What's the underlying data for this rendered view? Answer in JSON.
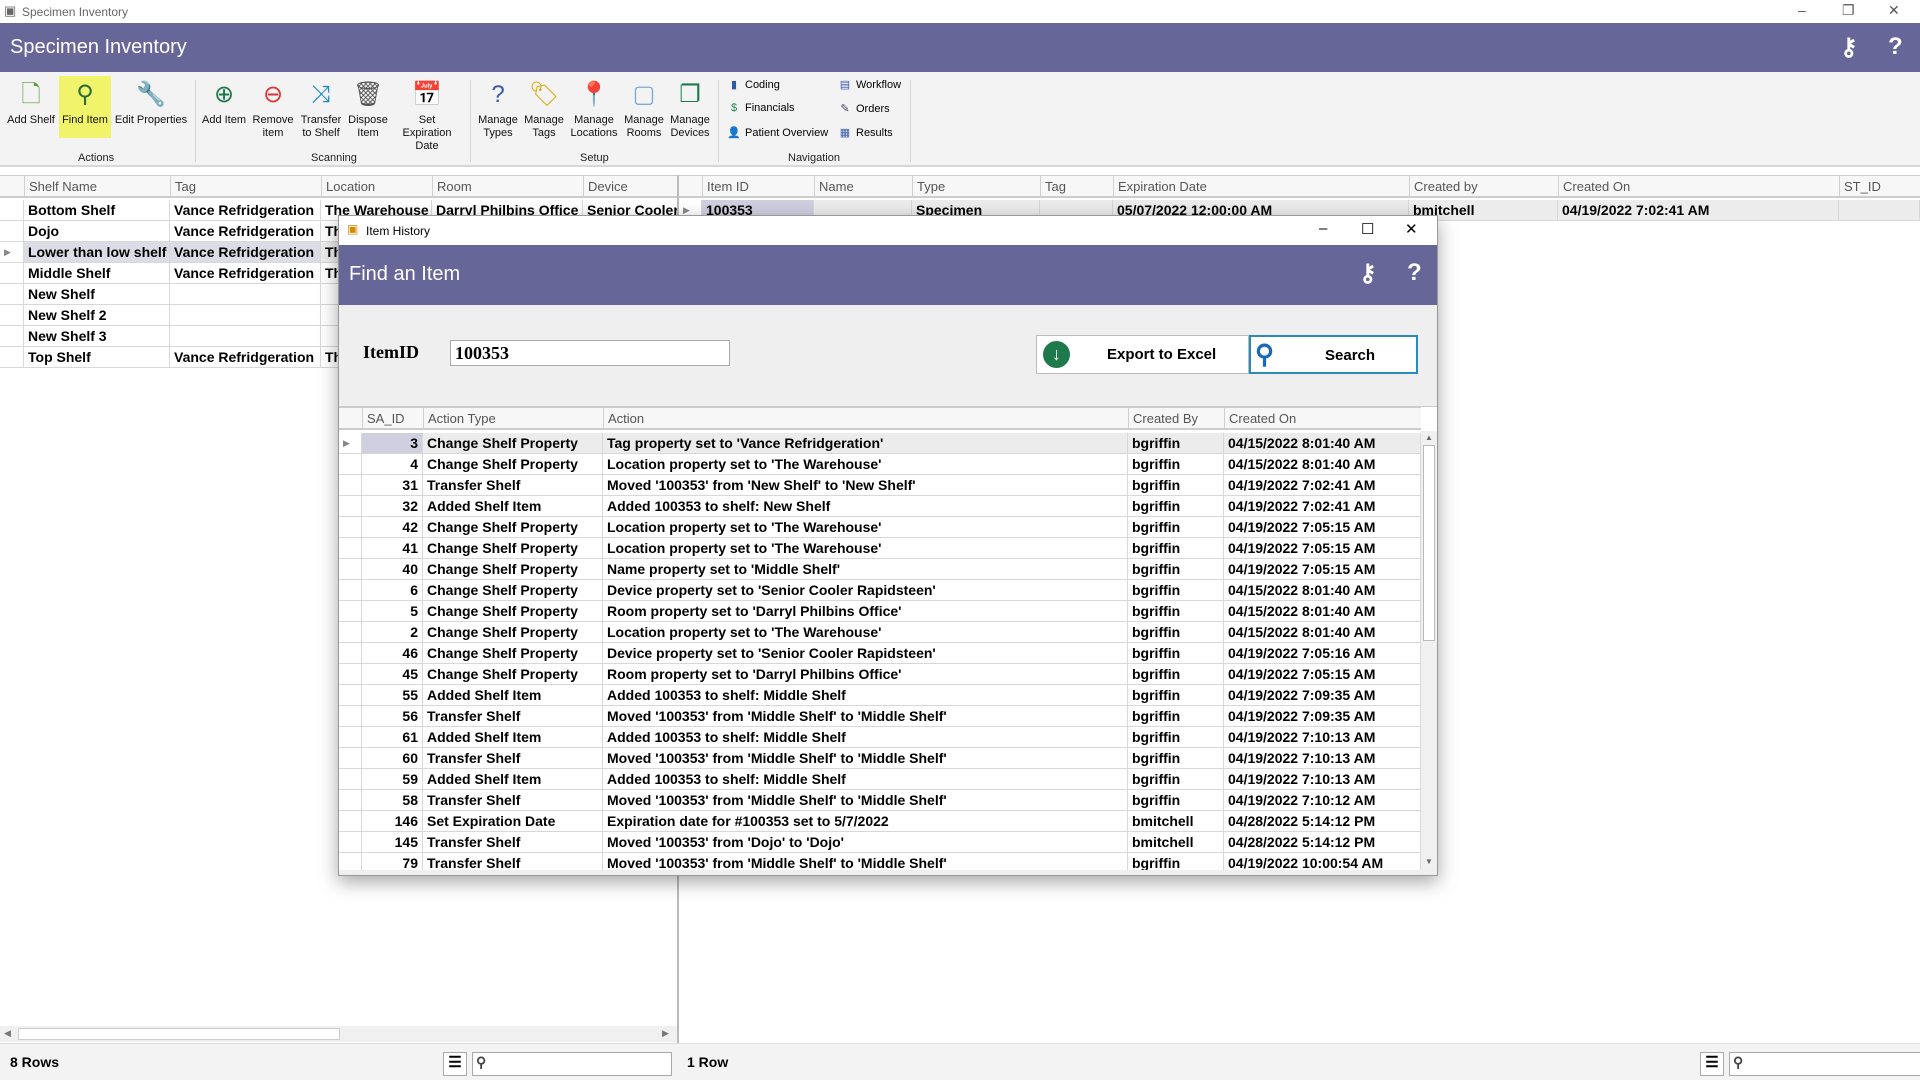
{
  "window": {
    "title": "Specimen Inventory",
    "controls": {
      "minimize": "–",
      "restore": "❐",
      "close": "✕"
    }
  },
  "app_header": {
    "title": "Specimen Inventory",
    "keys_icon": "keys-icon",
    "help": "?"
  },
  "colors": {
    "header": "#676698",
    "selected_ribbon": "#f1f36a",
    "excel_green": "#1e7a4a"
  },
  "ribbon": {
    "actions": {
      "label": "Actions",
      "items": [
        {
          "label": "Add Shelf"
        },
        {
          "label": "Find Item",
          "selected": true
        },
        {
          "label": "Edit Properties"
        }
      ]
    },
    "scanning": {
      "label": "Scanning",
      "items": [
        {
          "label": "Add Item"
        },
        {
          "label": "Remove item"
        },
        {
          "label": "Transfer to Shelf"
        },
        {
          "label": "Dispose Item"
        },
        {
          "label": "Set Expiration Date"
        }
      ]
    },
    "setup": {
      "label": "Setup",
      "items": [
        {
          "label": "Manage Types"
        },
        {
          "label": "Manage Tags"
        },
        {
          "label": "Manage Locations"
        },
        {
          "label": "Manage Rooms"
        },
        {
          "label": "Manage Devices"
        }
      ]
    },
    "navigation": {
      "label": "Navigation",
      "items": [
        {
          "label": "Coding"
        },
        {
          "label": "Financials"
        },
        {
          "label": "Patient Overview"
        },
        {
          "label": "Workflow"
        },
        {
          "label": "Orders"
        },
        {
          "label": "Results"
        }
      ]
    }
  },
  "shelves": {
    "columns": [
      "Shelf Name",
      "Tag",
      "Location",
      "Room",
      "Device"
    ],
    "rows": [
      [
        "Bottom Shelf",
        "Vance Refridgeration",
        "The Warehouse",
        "Darryl Philbins Office",
        "Senior Cooler Rapidsteen"
      ],
      [
        "Dojo",
        "Vance Refridgeration",
        "The Warehouse",
        "",
        ""
      ],
      [
        "Lower than low shelf",
        "Vance Refridgeration",
        "The Warehouse",
        "",
        ""
      ],
      [
        "Middle Shelf",
        "Vance Refridgeration",
        "The Warehouse",
        "",
        ""
      ],
      [
        "New Shelf",
        "",
        "",
        "",
        ""
      ],
      [
        "New Shelf 2",
        "",
        "",
        "",
        ""
      ],
      [
        "New Shelf 3",
        "",
        "",
        "",
        ""
      ],
      [
        "Top Shelf",
        "Vance Refridgeration",
        "The Warehouse",
        "",
        ""
      ]
    ],
    "selected_row": 2,
    "row_count": "8 Rows"
  },
  "items": {
    "columns": [
      "Item ID",
      "Name",
      "Type",
      "Tag",
      "Expiration Date",
      "Created by",
      "Created On",
      "ST_ID"
    ],
    "rows": [
      [
        "100353",
        "",
        "Specimen",
        "",
        "05/07/2022 12:00:00 AM",
        "bmitchell",
        "04/19/2022 7:02:41 AM",
        ""
      ]
    ],
    "row_count": "1 Row"
  },
  "dialog": {
    "title": "Item History",
    "header": "Find an Item",
    "item_id_label": "ItemID",
    "item_id_value": "100353",
    "export_label": "Export to Excel",
    "search_label": "Search",
    "columns": [
      "SA_ID",
      "Action Type",
      "Action",
      "Created By",
      "Created On"
    ],
    "rows": [
      [
        "3",
        "Change Shelf Property",
        "Tag property set to 'Vance Refridgeration'",
        "bgriffin",
        "04/15/2022 8:01:40 AM"
      ],
      [
        "4",
        "Change Shelf Property",
        "Location property set to 'The Warehouse'",
        "bgriffin",
        "04/15/2022 8:01:40 AM"
      ],
      [
        "31",
        "Transfer Shelf",
        "Moved '100353' from 'New Shelf' to 'New Shelf'",
        "bgriffin",
        "04/19/2022 7:02:41 AM"
      ],
      [
        "32",
        "Added Shelf Item",
        "Added 100353 to shelf: New Shelf",
        "bgriffin",
        "04/19/2022 7:02:41 AM"
      ],
      [
        "42",
        "Change Shelf Property",
        "Location property set to 'The Warehouse'",
        "bgriffin",
        "04/19/2022 7:05:15 AM"
      ],
      [
        "41",
        "Change Shelf Property",
        "Location property set to 'The Warehouse'",
        "bgriffin",
        "04/19/2022 7:05:15 AM"
      ],
      [
        "40",
        "Change Shelf Property",
        "Name property set to 'Middle Shelf'",
        "bgriffin",
        "04/19/2022 7:05:15 AM"
      ],
      [
        "6",
        "Change Shelf Property",
        "Device property set to 'Senior Cooler Rapidsteen'",
        "bgriffin",
        "04/15/2022 8:01:40 AM"
      ],
      [
        "5",
        "Change Shelf Property",
        "Room property set to 'Darryl Philbins Office'",
        "bgriffin",
        "04/15/2022 8:01:40 AM"
      ],
      [
        "2",
        "Change Shelf Property",
        "Location property set to 'The Warehouse'",
        "bgriffin",
        "04/15/2022 8:01:40 AM"
      ],
      [
        "46",
        "Change Shelf Property",
        "Device property set to 'Senior Cooler Rapidsteen'",
        "bgriffin",
        "04/19/2022 7:05:16 AM"
      ],
      [
        "45",
        "Change Shelf Property",
        "Room property set to 'Darryl Philbins Office'",
        "bgriffin",
        "04/19/2022 7:05:15 AM"
      ],
      [
        "55",
        "Added Shelf Item",
        "Added 100353 to shelf: Middle Shelf",
        "bgriffin",
        "04/19/2022 7:09:35 AM"
      ],
      [
        "56",
        "Transfer Shelf",
        "Moved '100353' from 'Middle Shelf' to 'Middle Shelf'",
        "bgriffin",
        "04/19/2022 7:09:35 AM"
      ],
      [
        "61",
        "Added Shelf Item",
        "Added 100353 to shelf: Middle Shelf",
        "bgriffin",
        "04/19/2022 7:10:13 AM"
      ],
      [
        "60",
        "Transfer Shelf",
        "Moved '100353' from 'Middle Shelf' to 'Middle Shelf'",
        "bgriffin",
        "04/19/2022 7:10:13 AM"
      ],
      [
        "59",
        "Added Shelf Item",
        "Added 100353 to shelf: Middle Shelf",
        "bgriffin",
        "04/19/2022 7:10:13 AM"
      ],
      [
        "58",
        "Transfer Shelf",
        "Moved '100353' from 'Middle Shelf' to 'Middle Shelf'",
        "bgriffin",
        "04/19/2022 7:10:12 AM"
      ],
      [
        "146",
        "Set Expiration Date",
        "Expiration date for #100353 set to 5/7/2022",
        "bmitchell",
        "04/28/2022 5:14:12 PM"
      ],
      [
        "145",
        "Transfer Shelf",
        "Moved '100353' from 'Dojo' to 'Dojo'",
        "bmitchell",
        "04/28/2022 5:14:12 PM"
      ],
      [
        "79",
        "Transfer Shelf",
        "Moved '100353' from 'Middle Shelf' to 'Middle Shelf'",
        "bgriffin",
        "04/19/2022 10:00:54 AM"
      ]
    ]
  }
}
